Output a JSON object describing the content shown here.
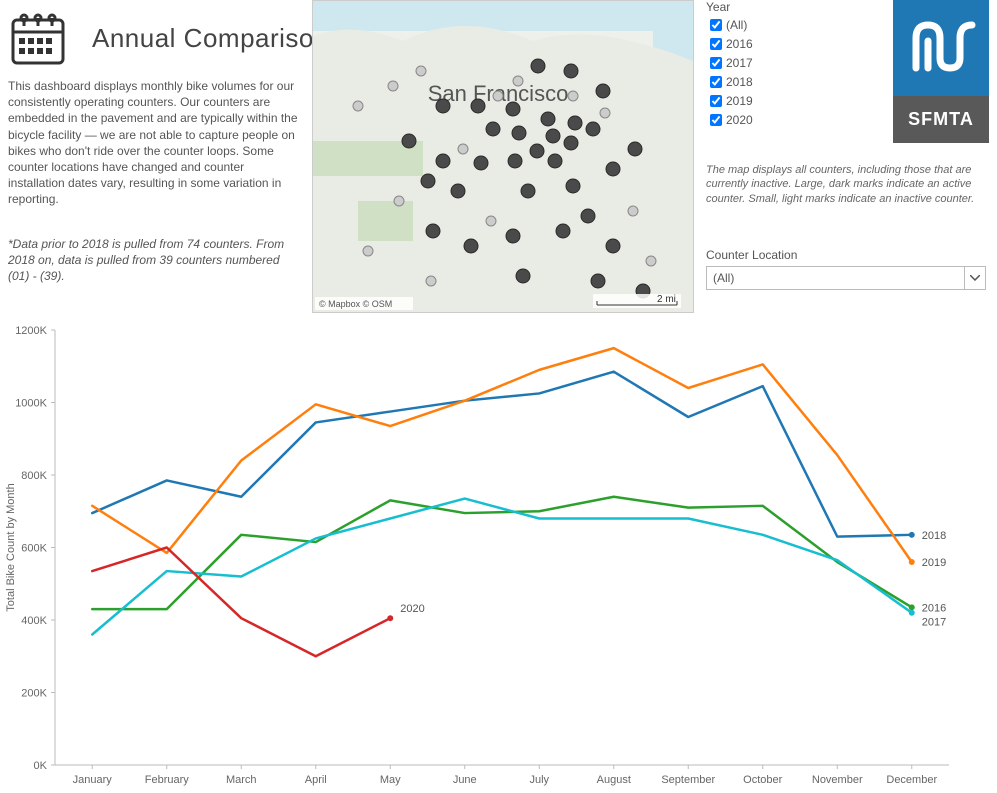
{
  "header": {
    "title": "Annual Comparison",
    "description": "This dashboard displays monthly bike volumes for our consistently operating counters. Our counters are embedded in the pavement and are typically within the bicycle facility — we are not able to capture people on bikes who don't ride over the counter loops. Some counter locations have changed and counter installation dates vary, resulting in some variation in reporting.",
    "note": "*Data prior to 2018 is pulled from 74 counters. From 2018 on, data is pulled from 39 counters numbered (01) - (39)."
  },
  "logo": {
    "text": "SFMTA"
  },
  "year_filter": {
    "label": "Year",
    "options": [
      "(All)",
      "2016",
      "2017",
      "2018",
      "2019",
      "2020"
    ]
  },
  "map": {
    "city_label": "San Francisco",
    "scale_label": "2 mi",
    "attribution": "© Mapbox © OSM",
    "note": "The map displays all counters, including those that are currently inactive. Large, dark marks indicate an active counter. Small, light marks indicate an inactive counter."
  },
  "counter_location": {
    "label": "Counter Location",
    "selected": "(All)"
  },
  "chart_data": {
    "type": "line",
    "title": "",
    "xlabel": "",
    "ylabel": "Total Bike Count by Month",
    "categories": [
      "January",
      "February",
      "March",
      "April",
      "May",
      "June",
      "July",
      "August",
      "September",
      "October",
      "November",
      "December"
    ],
    "ylim": [
      0,
      1200000
    ],
    "yticks": [
      "0K",
      "200K",
      "400K",
      "600K",
      "800K",
      "1000K",
      "1200K"
    ],
    "series": [
      {
        "name": "2016",
        "color": "#2ca02c",
        "values": [
          430000,
          430000,
          635000,
          615000,
          730000,
          695000,
          700000,
          740000,
          710000,
          715000,
          560000,
          435000
        ]
      },
      {
        "name": "2017",
        "color": "#17becf",
        "values": [
          360000,
          535000,
          520000,
          625000,
          680000,
          735000,
          680000,
          680000,
          680000,
          635000,
          565000,
          420000
        ]
      },
      {
        "name": "2018",
        "color": "#1f77b4",
        "values": [
          695000,
          785000,
          740000,
          945000,
          975000,
          1005000,
          1025000,
          1085000,
          960000,
          1045000,
          630000,
          635000
        ]
      },
      {
        "name": "2019",
        "color": "#ff7f0e",
        "values": [
          715000,
          585000,
          840000,
          995000,
          935000,
          1005000,
          1090000,
          1150000,
          1040000,
          1105000,
          855000,
          560000
        ]
      },
      {
        "name": "2020",
        "color": "#d62728",
        "values": [
          535000,
          600000,
          405000,
          300000,
          405000
        ]
      }
    ],
    "end_labels": {
      "2016": "2016",
      "2017": "2017",
      "2018": "2018",
      "2019": "2019",
      "2020": "2020"
    }
  }
}
